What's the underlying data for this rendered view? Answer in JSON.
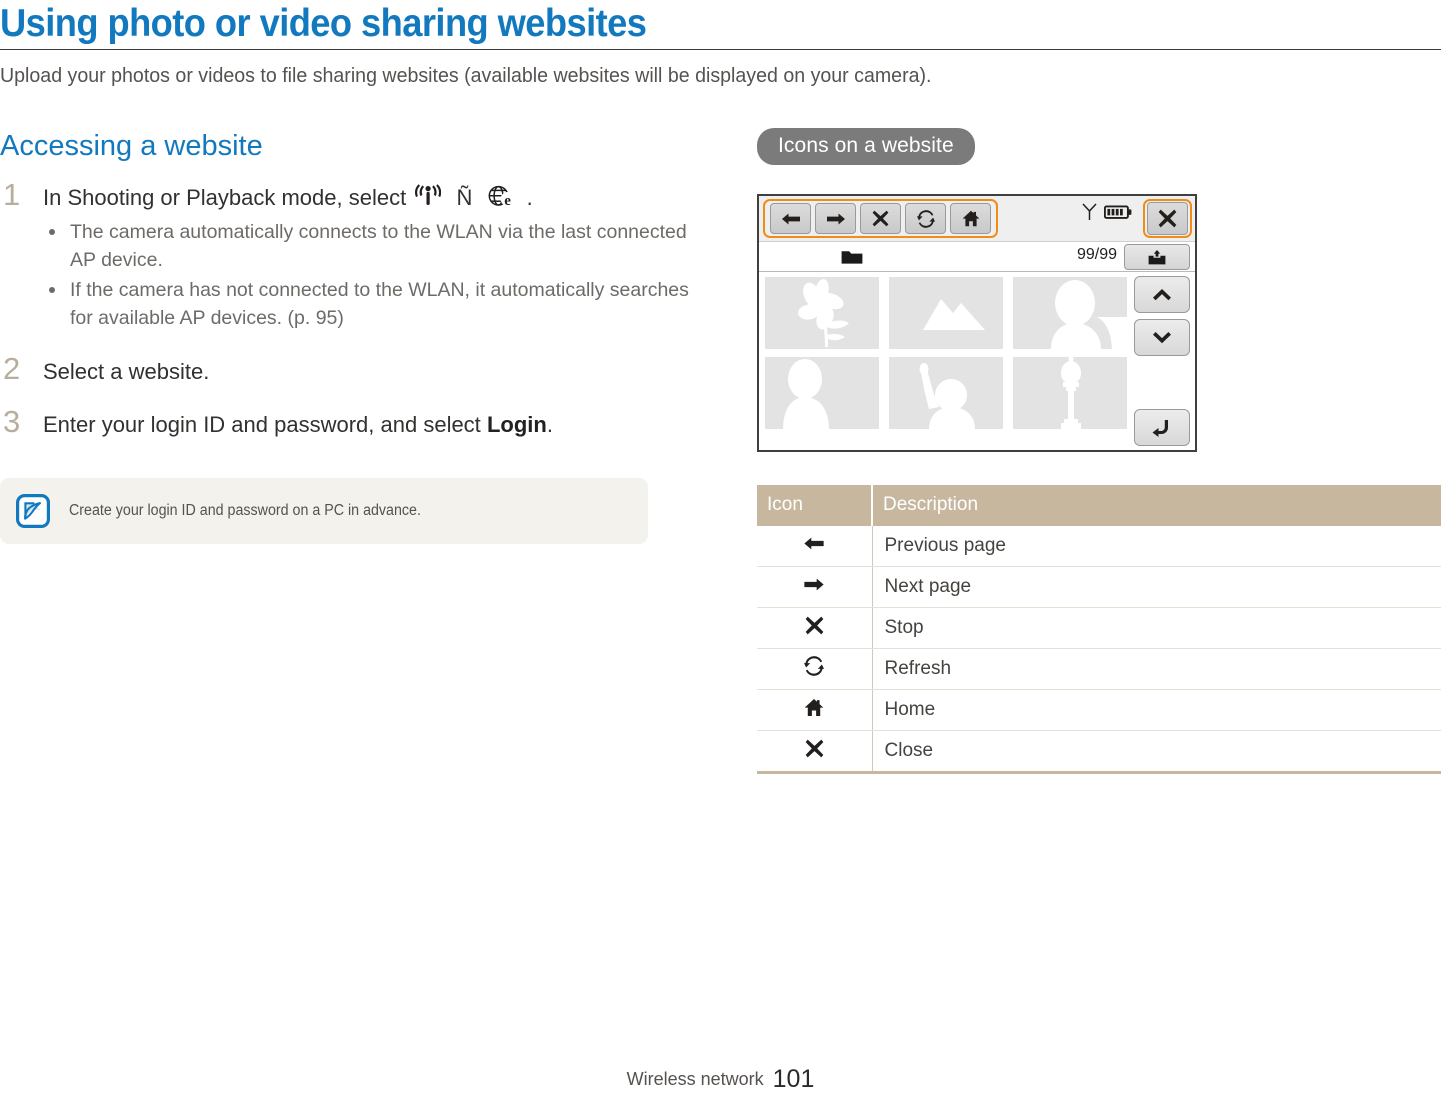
{
  "page": {
    "title": "Using photo or video sharing websites",
    "subtitle": "Upload your photos or videos to file sharing websites (available websites will be displayed on your camera)."
  },
  "left": {
    "section_title": "Accessing a website",
    "steps": [
      {
        "num": "1",
        "text_before": "In Shooting or Playback mode, select",
        "icons": [
          "wifi-broadcast-icon",
          "arrow-right-glyph",
          "globe-e-icon"
        ],
        "arrow_glyph": "Ñ",
        "text_after": ".",
        "bullets": [
          "The camera automatically connects to the WLAN via the last connected AP device.",
          "If the camera has not connected to the WLAN, it automatically searches for available AP devices. (p. 95)"
        ]
      },
      {
        "num": "2",
        "text_before": "Select a website.",
        "text_after": "",
        "bullets": []
      },
      {
        "num": "3",
        "text_before": "Enter your login ID and password, and select",
        "bold_word": "Login",
        "text_after": ".",
        "bullets": []
      }
    ],
    "note": {
      "icon": "note-pen-icon",
      "text": "Create your login ID and password on a PC in advance."
    }
  },
  "right": {
    "badge": "Icons on a website",
    "camera_screen": {
      "toolbar_buttons": [
        {
          "name": "previous-page-button",
          "icon": "arrow-left-icon"
        },
        {
          "name": "next-page-button",
          "icon": "arrow-right-icon"
        },
        {
          "name": "stop-button",
          "icon": "x-icon"
        },
        {
          "name": "refresh-button",
          "icon": "refresh-icon"
        },
        {
          "name": "home-button",
          "icon": "home-icon"
        }
      ],
      "status_icons": [
        "antenna-signal-icon",
        "battery-icon"
      ],
      "close_button_icon": "x-icon",
      "folder_icon": "folder-icon",
      "count": "99/99",
      "upload_button_icon": "upload-icon",
      "thumbnails": [
        "flower-thumbnail",
        "mountain-thumbnail",
        "portrait-thumbnail",
        "person-thumbnail",
        "person-pointing-thumbnail",
        "street-lamp-thumbnail"
      ],
      "scroll_up_icon": "chevron-up-icon",
      "scroll_down_icon": "chevron-down-icon",
      "back_icon": "return-arrow-icon"
    },
    "table": {
      "headers": [
        "Icon",
        "Description"
      ],
      "rows": [
        {
          "icon": "arrow-left-icon",
          "description": "Previous page"
        },
        {
          "icon": "arrow-right-icon",
          "description": "Next page"
        },
        {
          "icon": "x-icon",
          "description": "Stop"
        },
        {
          "icon": "refresh-icon",
          "description": "Refresh"
        },
        {
          "icon": "home-icon",
          "description": "Home"
        },
        {
          "icon": "x-icon",
          "description": "Close"
        }
      ]
    }
  },
  "footer": {
    "label": "Wireless network",
    "page_number": "101"
  },
  "colors": {
    "accent_blue": "#1279bf",
    "step_number": "#b8ae9c",
    "table_header_bg": "#c7b79f",
    "badge_bg": "#7b7b7b",
    "highlight_orange": "#f08c18",
    "note_bg": "#f4f2ed"
  }
}
